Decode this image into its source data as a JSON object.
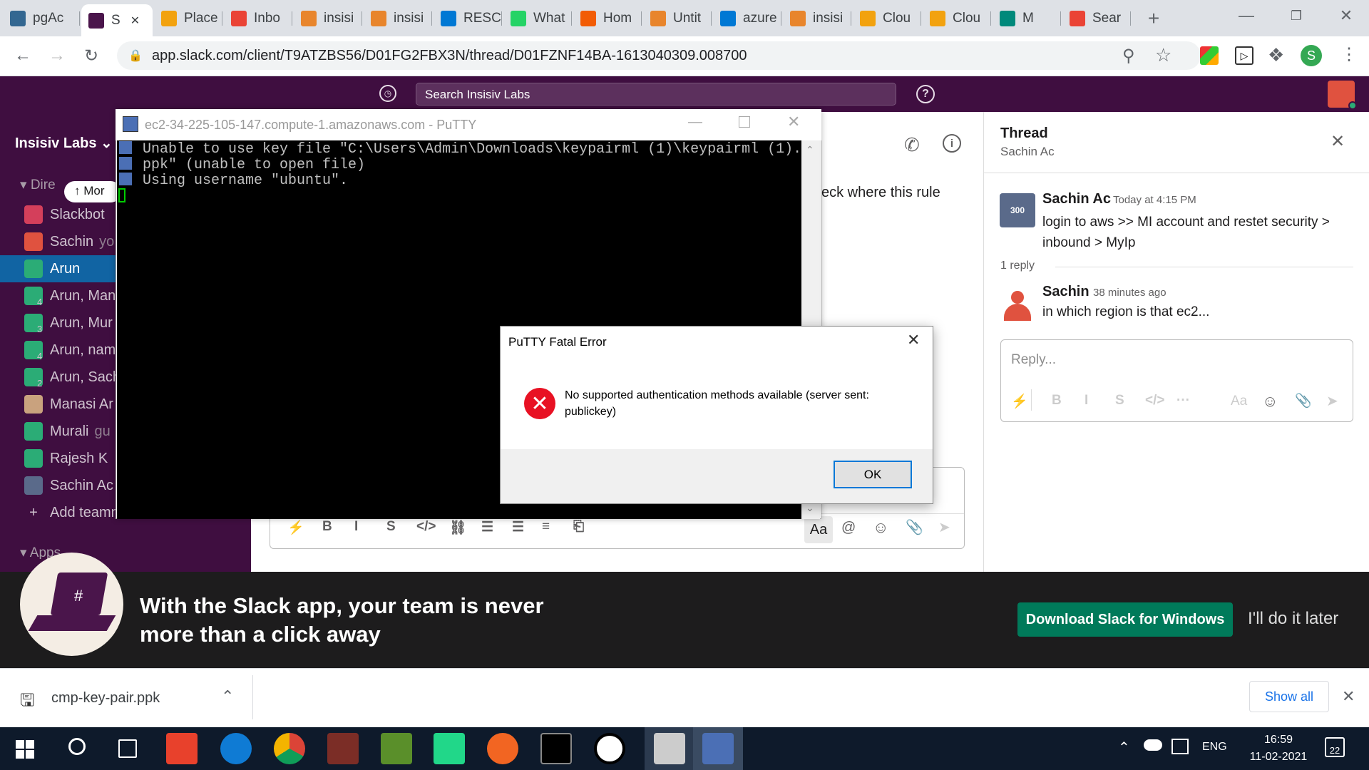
{
  "browser": {
    "tabs": [
      {
        "label": "pgAc",
        "icon": "pgadmin-icon",
        "color": "#336791"
      },
      {
        "label": "S",
        "icon": "slack-icon",
        "color": "#4a154b",
        "active": true
      },
      {
        "label": "Place",
        "icon": "aws-box-icon",
        "color": "#f2a20f"
      },
      {
        "label": "Inbo",
        "icon": "gmail-icon",
        "color": "#ea4335"
      },
      {
        "label": "insisi",
        "icon": "insisiv-icon",
        "color": "#e8852c"
      },
      {
        "label": "insisi",
        "icon": "insisiv-icon",
        "color": "#e8852c"
      },
      {
        "label": "RESC",
        "icon": "azure-icon",
        "color": "#0078d4"
      },
      {
        "label": "What",
        "icon": "whatsapp-icon",
        "color": "#25d366"
      },
      {
        "label": "Hom",
        "icon": "circle-icon",
        "color": "#f25c05"
      },
      {
        "label": "Untit",
        "icon": "doc-icon",
        "color": "#e8852c"
      },
      {
        "label": "azure",
        "icon": "microsoft-icon",
        "color": "#0078d4"
      },
      {
        "label": "insisi",
        "icon": "insisiv-icon",
        "color": "#e8852c"
      },
      {
        "label": "Clou",
        "icon": "aws-box-icon",
        "color": "#f2a20f"
      },
      {
        "label": "Clou",
        "icon": "aws-box-icon",
        "color": "#f2a20f"
      },
      {
        "label": "M",
        "icon": "meet-icon",
        "color": "#00897b"
      },
      {
        "label": "Sear",
        "icon": "gmail-icon",
        "color": "#ea4335"
      }
    ],
    "new_tab": "+",
    "url": "app.slack.com/client/T9ATZBS56/D01FG2FBX3N/thread/D01FZNF14BA-1613040309.008700",
    "profile_letter": "S"
  },
  "slack": {
    "search_placeholder": "Search Insisiv Labs",
    "workspace": "Insisiv Labs",
    "section_dm": "Dire",
    "more_unreads": "Mor",
    "section_apps": "Apps",
    "sidebar_items": [
      {
        "label": "Slackbot",
        "icon": "slackbot-icon",
        "color": "#d43f5b"
      },
      {
        "label": "Sachin",
        "suffix": "yo",
        "icon": "avatar-icon",
        "color": "#e0523f"
      },
      {
        "label": "Arun",
        "icon": "avatar-icon",
        "color": "#2bac76",
        "selected": true
      },
      {
        "label": "Arun, Man",
        "badge": "4",
        "icon": "group-icon",
        "color": "#2bac76"
      },
      {
        "label": "Arun, Mur",
        "badge": "3",
        "icon": "group-icon",
        "color": "#2bac76"
      },
      {
        "label": "Arun, nam",
        "badge": "4",
        "icon": "group-icon",
        "color": "#2bac76"
      },
      {
        "label": "Arun, Sach",
        "badge": "2",
        "icon": "group-icon",
        "color": "#2bac76"
      },
      {
        "label": "Manasi Ar",
        "icon": "avatar-photo-icon",
        "color": "#c9a27e"
      },
      {
        "label": "Murali",
        "suffix": "gu",
        "icon": "avatar-icon",
        "color": "#2bac76"
      },
      {
        "label": "Rajesh K",
        "icon": "avatar-icon",
        "color": "#2bac76"
      },
      {
        "label": "Sachin Ac",
        "icon": "avatar-logo-icon",
        "color": "#5a6a8a"
      },
      {
        "label": "Add teamm",
        "icon": "plus-icon",
        "color": "#3f0e40"
      }
    ],
    "main_snippet": "eck where this rule",
    "composer_aa": "Aa",
    "thread": {
      "title": "Thread",
      "subtitle": "Sachin Ac",
      "messages": [
        {
          "author": "Sachin Ac",
          "time": "Today at 4:15 PM",
          "text": "login to aws >> MI account and restet security > inbound > MyIp"
        },
        {
          "author": "Sachin",
          "time": "38 minutes ago",
          "text": "in which region is that ec2..."
        }
      ],
      "reply_count": "1 reply",
      "reply_placeholder": "Reply...",
      "reply_aa": "Aa"
    },
    "banner": {
      "headline_line1": "With the Slack app, your team is never",
      "headline_line2": "more than a click away",
      "download_button": "Download Slack for Windows",
      "later_button": "I'll do it later"
    }
  },
  "putty": {
    "title": "ec2-34-225-105-147.compute-1.amazonaws.com - PuTTY",
    "terminal_lines": [
      "Unable to use key file \"C:\\Users\\Admin\\Downloads\\keypairml (1)\\keypairml (1).",
      "ppk\" (unable to open file)",
      "Using username \"ubuntu\"."
    ]
  },
  "dialog": {
    "title": "PuTTY Fatal Error",
    "message": "No supported authentication methods available (server sent: publickey)",
    "ok": "OK"
  },
  "downloads": {
    "filename": "cmp-key-pair.ppk",
    "show_all": "Show all"
  },
  "taskbar": {
    "lang": "ENG",
    "time": "16:59",
    "date": "11-02-2021",
    "notifications": "22"
  }
}
